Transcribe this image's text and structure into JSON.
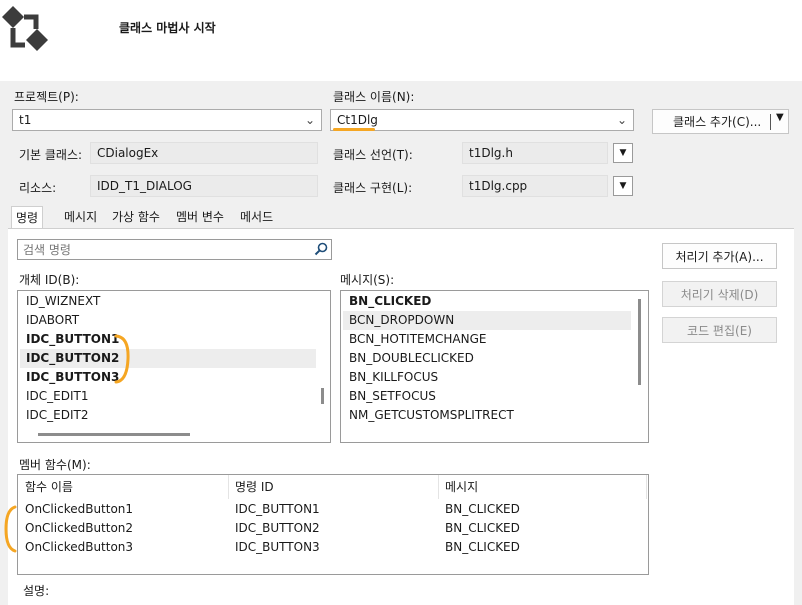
{
  "header": {
    "title": "클래스 마법사 시작"
  },
  "project": {
    "label": "프로젝트(P):",
    "value": "t1"
  },
  "class_name": {
    "label": "클래스 이름(N):",
    "value": "Ct1Dlg"
  },
  "add_class_button": {
    "label": "클래스 추가(C)..."
  },
  "base_class": {
    "label": "기본 클래스:",
    "value": "CDialogEx"
  },
  "resource": {
    "label": "리소스:",
    "value": "IDD_T1_DIALOG"
  },
  "class_declaration": {
    "label": "클래스 선언(T):",
    "value": "t1Dlg.h"
  },
  "class_implementation": {
    "label": "클래스 구현(L):",
    "value": "t1Dlg.cpp"
  },
  "tabs": [
    {
      "label": "명령"
    },
    {
      "label": "메시지"
    },
    {
      "label": "가상 함수"
    },
    {
      "label": "멤버 변수"
    },
    {
      "label": "메서드"
    }
  ],
  "search": {
    "placeholder": "검색 명령"
  },
  "object_ids": {
    "label": "개체 ID(B):",
    "items": [
      {
        "text": "ID_WIZNEXT"
      },
      {
        "text": "IDABORT"
      },
      {
        "text": "IDC_BUTTON1"
      },
      {
        "text": "IDC_BUTTON2"
      },
      {
        "text": "IDC_BUTTON3"
      },
      {
        "text": "IDC_EDIT1"
      },
      {
        "text": "IDC_EDIT2"
      }
    ]
  },
  "messages": {
    "label": "메시지(S):",
    "items": [
      {
        "text": "BN_CLICKED"
      },
      {
        "text": "BCN_DROPDOWN"
      },
      {
        "text": "BCN_HOTITEMCHANGE"
      },
      {
        "text": "BN_DOUBLECLICKED"
      },
      {
        "text": "BN_KILLFOCUS"
      },
      {
        "text": "BN_SETFOCUS"
      },
      {
        "text": "NM_GETCUSTOMSPLITRECT"
      }
    ]
  },
  "buttons": {
    "add_handler": "처리기 추가(A)...",
    "delete_handler": "처리기 삭제(D)",
    "edit_code": "코드 편집(E)"
  },
  "member_functions": {
    "label": "멤버 함수(M):",
    "columns": [
      "함수 이름",
      "명령 ID",
      "메시지"
    ],
    "rows": [
      [
        "OnClickedButton1",
        "IDC_BUTTON1",
        "BN_CLICKED"
      ],
      [
        "OnClickedButton2",
        "IDC_BUTTON2",
        "BN_CLICKED"
      ],
      [
        "OnClickedButton3",
        "IDC_BUTTON3",
        "BN_CLICKED"
      ]
    ]
  },
  "description": {
    "label": "설명:"
  },
  "colors": {
    "annotation": "#f5a623",
    "selection": "#ededed"
  }
}
